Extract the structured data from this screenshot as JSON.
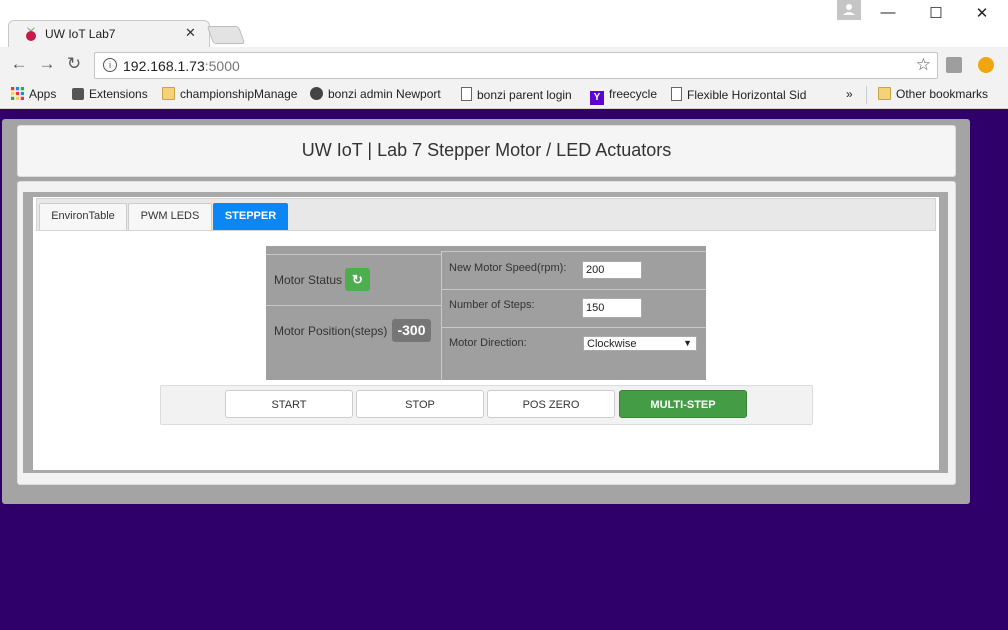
{
  "browser": {
    "tab_title": "UW IoT Lab7",
    "url_host": "192.168.1.73",
    "url_port": ":5000",
    "window_controls": {
      "minimize": "—",
      "maximize": "☐",
      "close": "✕"
    },
    "bookmarks": [
      {
        "label": "Apps",
        "icon": "apps-grid-icon"
      },
      {
        "label": "Extensions",
        "icon": "puzzle-icon"
      },
      {
        "label": "championshipManage",
        "icon": "folder-icon"
      },
      {
        "label": "bonzi admin Newport",
        "icon": "bonzi-icon"
      },
      {
        "label": "bonzi parent login",
        "icon": "page-icon"
      },
      {
        "label": "freecycle",
        "icon": "yahoo-icon"
      },
      {
        "label": "Flexible Horizontal Sid",
        "icon": "page-icon"
      }
    ],
    "more_bookmarks": "»",
    "other_bookmarks": "Other bookmarks"
  },
  "page": {
    "title": "UW IoT | Lab 7 Stepper Motor / LED Actuators",
    "tabs": [
      {
        "label": "EnvironTable",
        "active": false
      },
      {
        "label": "PWM LEDS",
        "active": false
      },
      {
        "label": "STEPPER",
        "active": true
      }
    ],
    "motor": {
      "status_label": "Motor Status",
      "status_icon": "refresh-icon",
      "position_label": "Motor Position(steps)",
      "position_value": "-300",
      "speed_label": "New Motor Speed(rpm):",
      "speed_value": "200",
      "steps_label": "Number of Steps:",
      "steps_value": "150",
      "direction_label": "Motor Direction:",
      "direction_value": "Clockwise"
    },
    "buttons": {
      "start": "START",
      "stop": "STOP",
      "pos_zero": "POS ZERO",
      "multi_step": "MULTI-STEP"
    }
  },
  "colors": {
    "page_background": "#2f0069",
    "active_tab": "#0b87f5",
    "status_green": "#4cae4c",
    "multi_step_green": "#449d44"
  }
}
